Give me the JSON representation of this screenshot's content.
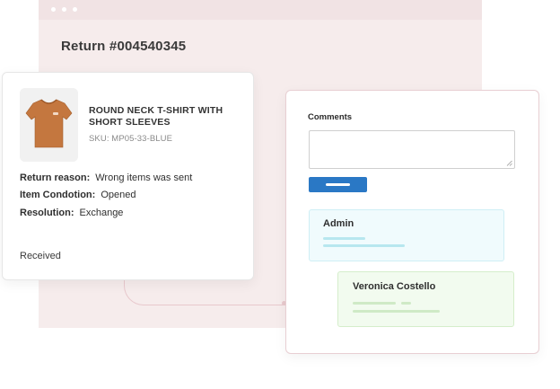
{
  "return_page": {
    "title": "Return #004540345"
  },
  "product": {
    "image_icon": "tshirt-image",
    "name": "ROUND NECK T-SHIRT WITH SHORT SLEEVES",
    "sku": "SKU: MP05-33-BLUE",
    "details": [
      {
        "label": "Return reason:",
        "value": "Wrong items was sent"
      },
      {
        "label": "Item Condotion:",
        "value": "Opened"
      },
      {
        "label": "Resolution:",
        "value": "Exchange"
      }
    ],
    "status": "Received"
  },
  "comments": {
    "label": "Comments",
    "input_value": "",
    "submit_color": "#2a78c5",
    "messages": [
      {
        "author": "Admin",
        "color": "#f0fbfd"
      },
      {
        "author": "Veronica Costello",
        "color": "#f2fbef"
      }
    ]
  }
}
